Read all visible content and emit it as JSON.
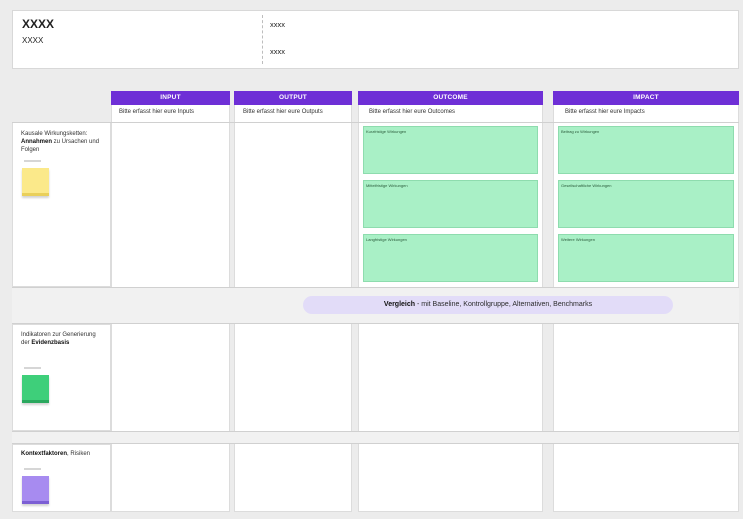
{
  "header": {
    "title": "XXXX",
    "subtitle": "XXXX",
    "right_line1": "xxxx",
    "right_line2": "xxxx"
  },
  "columns": [
    {
      "label": "INPUT",
      "prompt": "Bitte erfasst hier eure Inputs"
    },
    {
      "label": "OUTPUT",
      "prompt": "Bitte erfasst hier eure Outputs"
    },
    {
      "label": "OUTCOME",
      "prompt": "Bitte erfasst hier eure Outcomes"
    },
    {
      "label": "IMPACT",
      "prompt": "Bitte erfasst hier eure Impacts"
    }
  ],
  "rows": {
    "assumptions": {
      "pre": "Kausale Wirkungsketten: ",
      "bold": "Annahmen",
      "post": " zu Ursachen und Folgen",
      "sticky_color": "#fbe98a"
    },
    "indicators": {
      "pre": "Indikatoren zur Generierung der ",
      "bold": "Evidenzbasis",
      "post": "",
      "sticky_color": "#3ecf7a"
    },
    "context": {
      "pre": "",
      "bold": "Kontextfaktoren",
      "post": ", Risiken",
      "sticky_color": "#a78bf0"
    }
  },
  "outcome_notes": [
    "Kurzfristige Wirkungen",
    "Mittelfristige Wirkungen",
    "Langfristige Wirkungen"
  ],
  "impact_notes": [
    "Beitrag zu Wirkungen",
    "Gesellschaftliche Wirkungen",
    "Weitere Wirkungen"
  ],
  "comparison": {
    "bold": "Vergleich",
    "rest": " - mit Baseline, Kontrollgruppe, Alternativen, Benchmarks"
  }
}
